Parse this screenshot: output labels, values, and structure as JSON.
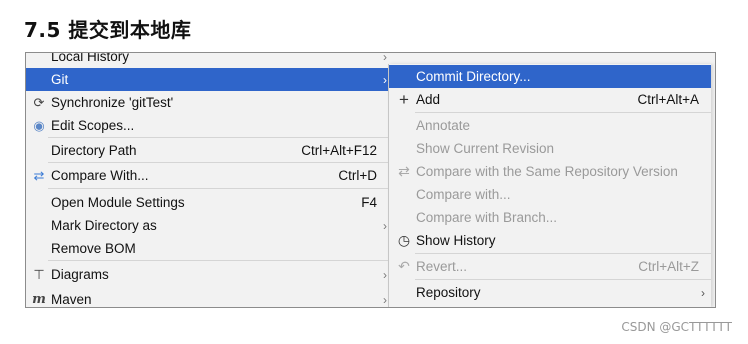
{
  "heading": "7.5  提交到本地库",
  "main_menu": {
    "items": [
      {
        "label": "Local History",
        "shortcut": "",
        "has_submenu": true,
        "icon": ""
      },
      {
        "label": "Git",
        "shortcut": "",
        "has_submenu": true,
        "icon": "",
        "selected": true
      },
      {
        "label": "Synchronize 'gitTest'",
        "shortcut": "",
        "has_submenu": false,
        "icon": "sync-icon"
      },
      {
        "label": "Edit Scopes...",
        "shortcut": "",
        "has_submenu": false,
        "icon": "scope-icon"
      },
      {
        "label": "Directory Path",
        "shortcut": "Ctrl+Alt+F12",
        "has_submenu": false,
        "icon": ""
      },
      {
        "label": "Compare With...",
        "shortcut": "Ctrl+D",
        "has_submenu": false,
        "icon": "compare-icon"
      },
      {
        "label": "Open Module Settings",
        "shortcut": "F4",
        "has_submenu": false,
        "icon": ""
      },
      {
        "label": "Mark Directory as",
        "shortcut": "",
        "has_submenu": true,
        "icon": ""
      },
      {
        "label": "Remove BOM",
        "shortcut": "",
        "has_submenu": false,
        "icon": ""
      },
      {
        "label": "Diagrams",
        "shortcut": "",
        "has_submenu": true,
        "icon": "diagrams-icon"
      },
      {
        "label": "Maven",
        "shortcut": "",
        "has_submenu": true,
        "icon": "maven-icon"
      }
    ]
  },
  "git_submenu": {
    "items": [
      {
        "label": "Commit Directory...",
        "shortcut": "",
        "icon": "",
        "selected": true
      },
      {
        "label": "Add",
        "shortcut": "Ctrl+Alt+A",
        "icon": "plus-icon"
      },
      {
        "label": "Annotate",
        "shortcut": "",
        "icon": "",
        "disabled": true
      },
      {
        "label": "Show Current Revision",
        "shortcut": "",
        "icon": "",
        "disabled": true
      },
      {
        "label": "Compare with the Same Repository Version",
        "shortcut": "",
        "icon": "compare-icon",
        "disabled": true
      },
      {
        "label": "Compare with...",
        "shortcut": "",
        "icon": "",
        "disabled": true
      },
      {
        "label": "Compare with Branch...",
        "shortcut": "",
        "icon": "",
        "disabled": true
      },
      {
        "label": "Show History",
        "shortcut": "",
        "icon": "clock-icon"
      },
      {
        "label": "Revert...",
        "shortcut": "Ctrl+Alt+Z",
        "icon": "revert-icon",
        "disabled": true
      },
      {
        "label": "Repository",
        "shortcut": "",
        "icon": "",
        "has_submenu": true
      }
    ]
  },
  "colors": {
    "selection": "#2f65ca",
    "menu_bg": "#f2f2f2",
    "disabled_text": "#9a9a9a"
  },
  "watermark": "CSDN @GCTTTTTT"
}
